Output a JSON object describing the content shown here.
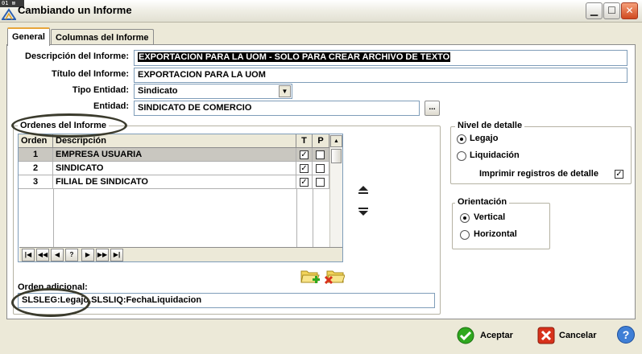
{
  "window": {
    "badge": "01 ⊠",
    "title": "Cambiando un Informe"
  },
  "tabs": [
    {
      "label": "General"
    },
    {
      "label": "Columnas del Informe"
    }
  ],
  "form": {
    "descripcion_label": "Descripción del Informe:",
    "descripcion_value": "EXPORTACION PARA LA UOM - SOLO PARA CREAR ARCHIVO DE TEXTO",
    "titulo_label": "Título del Informe:",
    "titulo_value": "EXPORTACION PARA LA UOM",
    "tipo_label": "Tipo Entidad:",
    "tipo_value": "Sindicato",
    "entidad_label": "Entidad:",
    "entidad_value": "SINDICATO DE COMERCIO",
    "entidad_button": "..."
  },
  "ordenes": {
    "title": "Ordenes del Informe",
    "columns": [
      "Orden",
      "Descripción",
      "T",
      "P"
    ],
    "rows": [
      {
        "orden": "1",
        "descripcion": "EMPRESA USUARIA",
        "t": true,
        "p": false
      },
      {
        "orden": "2",
        "descripcion": "SINDICATO",
        "t": true,
        "p": false
      },
      {
        "orden": "3",
        "descripcion": "FILIAL DE SINDICATO",
        "t": true,
        "p": false
      }
    ],
    "nav": [
      "|◀",
      "◀◀",
      "◀",
      "?",
      "▶",
      "▶▶",
      "▶|"
    ]
  },
  "orden_adicional": {
    "label": "Orden adicional:",
    "value": "SLSLEG:Legajo,SLSLIQ:FechaLiquidacion"
  },
  "nivel": {
    "title": "Nivel de detalle",
    "options": [
      {
        "label": "Legajo",
        "selected": true
      },
      {
        "label": "Liquidación",
        "selected": false
      }
    ],
    "imprimir_label": "Imprimir registros de detalle",
    "imprimir_checked": true
  },
  "orientacion": {
    "title": "Orientación",
    "options": [
      {
        "label": "Vertical",
        "selected": true
      },
      {
        "label": "Horizontal",
        "selected": false
      }
    ]
  },
  "buttons": {
    "aceptar": "Aceptar",
    "cancelar": "Cancelar",
    "help": "?"
  },
  "colors": {
    "accent_green": "#2fa81f",
    "cancel_red": "#d8321c",
    "help_blue": "#3f7fd6",
    "selected_row": "#c9c7c0"
  }
}
